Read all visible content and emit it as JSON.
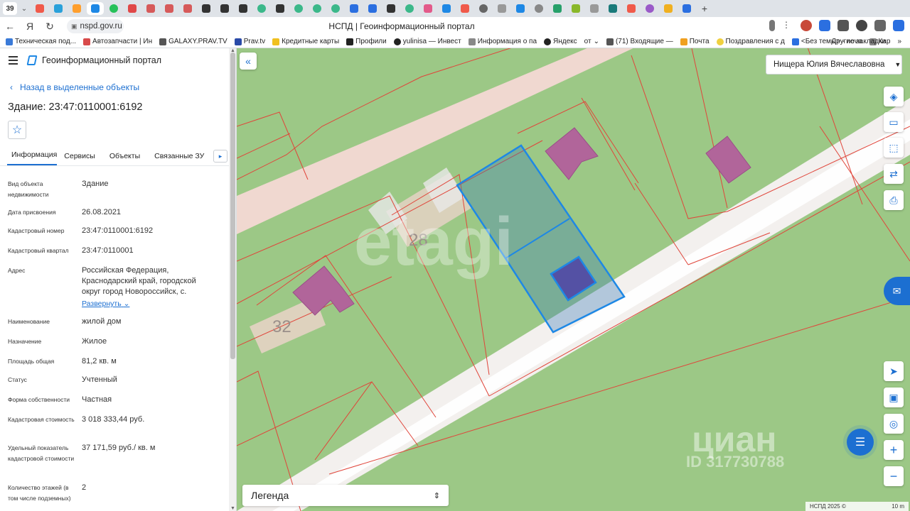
{
  "browser": {
    "tab_count": "39",
    "url": "nspd.gov.ru",
    "page_title": "НСПД | Геоинформационный портал",
    "bookmarks": [
      "Техническая под...",
      "Автозапчасти | Ин",
      "GALAXY.PRAV.TV",
      "Prav.tv",
      "Кредитные карты",
      "Профили",
      "yulinisa — Инвест",
      "Информация о па",
      "Яндекс",
      "от",
      "(71) Входящие —",
      "Почта",
      "Поздравления с д",
      "<Без темы> - nova",
      "Кар"
    ],
    "other_bookmarks": "Другие закладки"
  },
  "panel": {
    "app_name": "Геоинформационный портал",
    "back_label": "Назад в выделенные объекты",
    "object_title": "Здание: 23:47:0110001:6192",
    "tabs": [
      "Информация",
      "Сервисы",
      "Объекты",
      "Связанные ЗУ"
    ],
    "properties": [
      {
        "label": "Вид объекта недвижимости",
        "value": "Здание"
      },
      {
        "label": "Дата присвоения",
        "value": "26.08.2021"
      },
      {
        "label": "Кадастровый номер",
        "value": "23:47:0110001:6192"
      },
      {
        "label": "Кадастровый квартал",
        "value": "23:47:0110001"
      },
      {
        "label": "Адрес",
        "value": "Российская Федерация, Краснодарский край, городской округ город Новороссийск, с."
      },
      {
        "label": "Наименование",
        "value": "жилой дом"
      },
      {
        "label": "Назначение",
        "value": "Жилое"
      },
      {
        "label": "Площадь общая",
        "value": "81,2 кв. м"
      },
      {
        "label": "Статус",
        "value": "Учтенный"
      },
      {
        "label": "Форма собственности",
        "value": "Частная"
      },
      {
        "label": "Кадастровая стоимость",
        "value": "3 018 333,44 руб."
      },
      {
        "label": "Удельный показатель кадастровой стоимости",
        "value": "37 171,59 руб./ кв. м"
      },
      {
        "label": "Количество этажей (в том числе подземных)",
        "value": "2"
      }
    ],
    "expand_label": "Развернуть"
  },
  "map": {
    "user_name": "Нищера Юлия Вячеславовна",
    "legend_label": "Легенда",
    "scale_copyright": "НСПД 2025 ©",
    "scale_value": "10 m",
    "parcel_labels": [
      "28",
      "32"
    ],
    "watermark_etagi": "etagi",
    "watermark_cian": "циан",
    "watermark_id": "ID 317730788",
    "colors": {
      "land": "#9cc886",
      "road": "#f0d8d0",
      "building": "#b1659a",
      "selection": "#1e88e5",
      "boundary": "#e0453a"
    }
  }
}
